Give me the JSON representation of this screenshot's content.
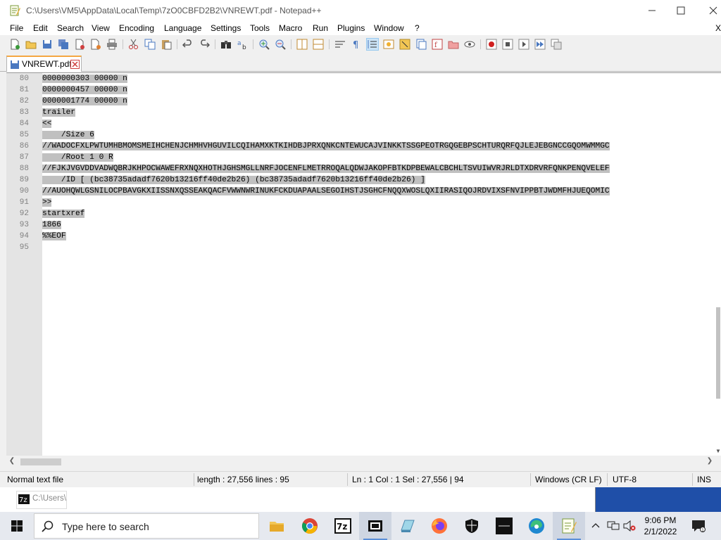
{
  "window": {
    "title": "C:\\Users\\VM5\\AppData\\Local\\Temp\\7zO0CBFD2B2\\VNREWT.pdf - Notepad++"
  },
  "menu": [
    "File",
    "Edit",
    "Search",
    "View",
    "Encoding",
    "Language",
    "Settings",
    "Tools",
    "Macro",
    "Run",
    "Plugins",
    "Window",
    "?"
  ],
  "menu_close": "X",
  "tab": {
    "label": "VNREWT.pdf"
  },
  "editor": {
    "lines": [
      {
        "num": "80",
        "text": "0000000303 00000 n"
      },
      {
        "num": "81",
        "text": "0000000457 00000 n"
      },
      {
        "num": "82",
        "text": "0000001774 00000 n"
      },
      {
        "num": "83",
        "text": "trailer"
      },
      {
        "num": "84",
        "text": "<<"
      },
      {
        "num": "85",
        "text": "    /Size 6"
      },
      {
        "num": "86",
        "text": "//WADOCFXLPWTUMHBMOMSMEIHCHENJCHMHVHGUVILCQIHAMXKTKIHDBJPRXQNKCNTEWUCAJVINKKTSSGPEOTRGQGEBPSCHTURQRFQJLEJEBGNCCGQOMWMMGC"
      },
      {
        "num": "87",
        "text": "    /Root 1 0 R"
      },
      {
        "num": "88",
        "text": "//FJKJVGVDDVADWQBRJKHPOCWAWEFRXNQXHOTHJGHSMGLLNRFJOCENFLMETRROQALQDWJAKOPFBTKDPBEWALCBCHLTSVUIWVRJRLDTXDRVRFQNKPENQVELEF"
      },
      {
        "num": "89",
        "text": "    /ID [ (bc38735adadf7620b13216ff40de2b26) (bc38735adadf7620b13216ff40de2b26) ]"
      },
      {
        "num": "90",
        "text": "//AUOHQWLGSNILOCPBAVGKXIISSNXQSSEAKQACFVWWNWRINUKFCKDUAPAALSEGOIHSTJSGHCFNQQXWOSLQXIIRASIQOJRDVIXSFNVIPPBTJWDMFHJUEQOMIC"
      },
      {
        "num": "91",
        "text": ">>"
      },
      {
        "num": "92",
        "text": "startxref"
      },
      {
        "num": "93",
        "text": "1866"
      },
      {
        "num": "94",
        "text": "%%EOF"
      },
      {
        "num": "95",
        "text": ""
      }
    ]
  },
  "status": {
    "type": "Normal text file",
    "length": "length : 27,556    lines : 95",
    "position": "Ln : 1    Col : 1    Sel : 27,556 | 94",
    "eol": "Windows (CR LF)",
    "encoding": "UTF-8",
    "mode": "INS"
  },
  "background_window": {
    "tab_label": "C:\\Users\\"
  },
  "taskbar": {
    "search_placeholder": "Type here to search",
    "time": "9:06 PM",
    "date": "2/1/2022",
    "apps": [
      "file-explorer",
      "chrome",
      "7zip",
      "media-player",
      "network-share",
      "firefox",
      "security-shield",
      "terminal-app",
      "edge",
      "notepad-plus-plus"
    ]
  }
}
